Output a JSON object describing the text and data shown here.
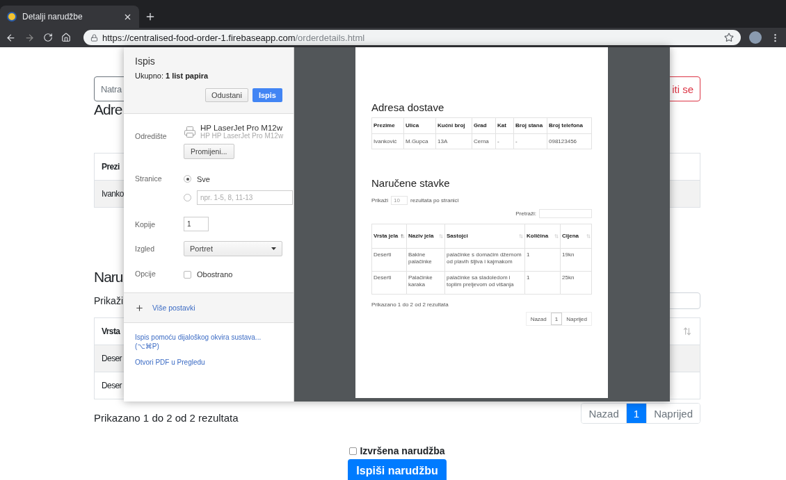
{
  "browser": {
    "tab_title": "Detalji narudžbe",
    "url_host": "https://centralised-food-order-1.firebaseapp.com",
    "url_path": "/orderdetails.html"
  },
  "page": {
    "back_button": "Natra",
    "logout_button": "iti se",
    "address_heading": "Adre",
    "address_table": {
      "header": "Prezi",
      "rows": [
        "Ivanko"
      ]
    },
    "items_heading": "Naru",
    "show_label": "Prikaži",
    "items_table": {
      "header": "Vrsta",
      "rows": [
        "Deser",
        "Deser"
      ]
    },
    "summary": "Prikazano 1 do 2 od 2 rezultata",
    "pagination": [
      {
        "label": "Nazad",
        "selected": false
      },
      {
        "label": "1",
        "selected": true
      },
      {
        "label": "Naprijed",
        "selected": false
      }
    ],
    "completed": {
      "label": "Izvršena narudžba",
      "checked": false
    },
    "print_button": "Ispiši narudžbu"
  },
  "print_dialog": {
    "title": "Ispis",
    "total": "Ukupno: **1 list papira**",
    "cancel_button": "Odustani",
    "print_button": "Ispis",
    "settings": [
      {
        "kind": "destination",
        "label": "Odredište",
        "printer_name": "HP LaserJet Pro M12w",
        "printer_detail": "HP HP LaserJet Pro M12w",
        "button": "Promijeni..."
      },
      {
        "kind": "pages",
        "label": "Stranice",
        "options": [
          {
            "label": "Sve",
            "selected": true
          },
          {
            "placeholder": "npr. 1-5, 8, 11-13",
            "selected": false
          }
        ]
      },
      {
        "kind": "input",
        "label": "Kopije",
        "value": "1"
      },
      {
        "kind": "select",
        "label": "Izgled",
        "value": "Portret"
      },
      {
        "kind": "checkbox",
        "label": "Opcije",
        "option": "Obostrano",
        "checked": false
      }
    ],
    "more_settings": "Više postavki",
    "links": [
      "Ispis pomoću dijaloškog okvira sustava... (⌥⌘P)",
      "Otvori PDF u Pregledu"
    ]
  },
  "preview": {
    "address_heading": "Adresa dostave",
    "address_table": {
      "columns": [
        "Prezime",
        "Ulica",
        "Kućni broj",
        "Grad",
        "Kat",
        "Broj stana",
        "Broj telefona"
      ],
      "rows": [
        [
          "Ivanković",
          "M.Gupca",
          "13A",
          "Cerna",
          "-",
          "-",
          "098123456"
        ]
      ]
    },
    "items_heading": "Naručene stavke",
    "show_label": "Prikaži",
    "show_value": "10",
    "show_suffix": "rezultata po stranici",
    "search_label": "Pretraži:",
    "items_table": {
      "columns": [
        {
          "label": "Vrsta jela",
          "sorted": true
        },
        {
          "label": "Naziv jela",
          "sorted": false
        },
        {
          "label": "Sastojci",
          "sorted": false
        },
        {
          "label": "Količina",
          "sorted": false
        },
        {
          "label": "Cijena",
          "sorted": false
        }
      ],
      "rows": [
        [
          "Deserti",
          "Bakine palačinke",
          "palačinke s domaćim džemom od plavih šljiva i kajmakom",
          "1",
          "19kn"
        ],
        [
          "Deserti",
          "Palačinke karaka",
          "palačinke sa sladoledom i toplim preljevom od višanja",
          "1",
          "25kn"
        ]
      ]
    },
    "summary": "Prikazano 1 do 2 od 2 rezultata",
    "pagination": [
      {
        "label": "Nazad",
        "selected": false
      },
      {
        "label": "1",
        "selected": true
      },
      {
        "label": "Naprijed",
        "selected": false
      }
    ]
  }
}
